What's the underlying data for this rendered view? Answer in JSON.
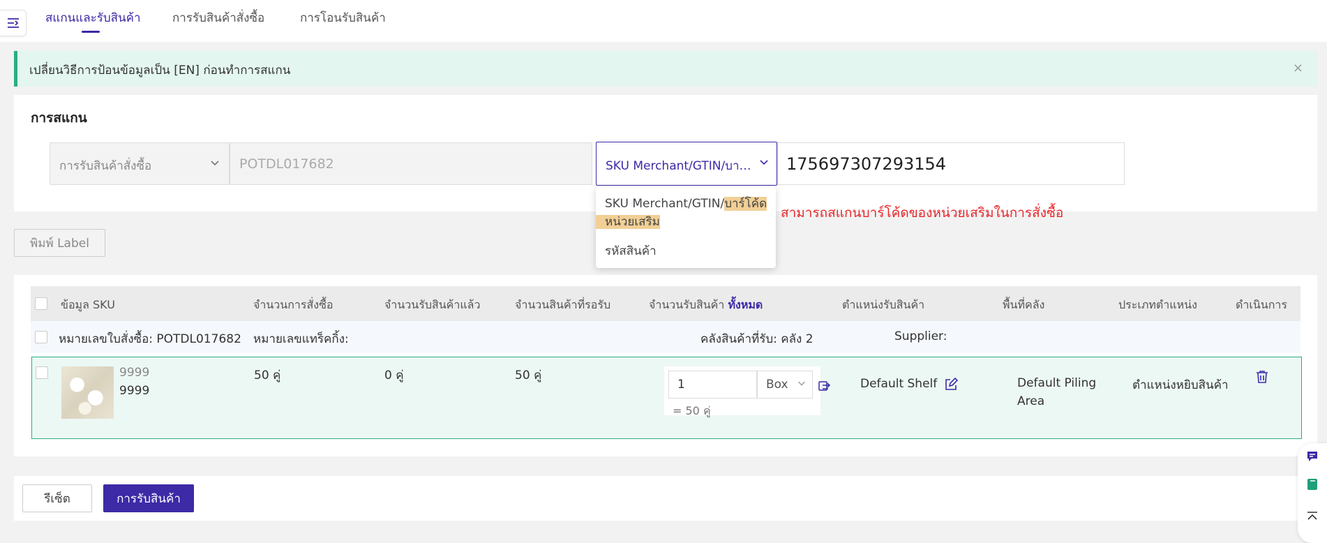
{
  "tabs": [
    {
      "label": "สแกนและรับสินค้า",
      "active": true
    },
    {
      "label": "การรับสินค้าสั่งซื้อ",
      "active": false
    },
    {
      "label": "การโอนรับสินค้า",
      "active": false
    }
  ],
  "alert": {
    "text": "เปลี่ยนวิธีการป้อนข้อมูลเป็น [EN] ก่อนทำการสแกน",
    "close": "×"
  },
  "scan": {
    "title": "การสแกน",
    "type_select": "การรับสินค้าสั่งซื้อ",
    "po_value": "POTDL017682",
    "code_type_select": "SKU Merchant/GTIN/บาร์โค้ด",
    "barcode_value": "175697307293154"
  },
  "dropdown": {
    "option1_part1": "SKU Merchant/GTIN/",
    "option1_part2": "บาร์โค้ด",
    "option1_part3": "หน่วยเสริม",
    "option2": "รหัสสินค้า",
    "annotation": "สามารถสแกนบาร์โค้ดของหน่วยเสริมในการสั่งซื้อ"
  },
  "print_label": "พิมพ์ Label",
  "table": {
    "headers": {
      "sku_info": "ข้อมูล SKU",
      "order_qty": "จำนวนการสั่งซื้อ",
      "received_qty": "จำนวนรับสินค้าแล้ว",
      "pending_qty": "จำนวนสินค้าที่รอรับ",
      "receive_qty": "จำนวนรับสินค้า",
      "receive_all": "ทั้งหมด",
      "location": "ตำแหน่งรับสินค้า",
      "warehouse_area": "พื้นที่คลัง",
      "location_type": "ประเภทตำแหน่ง",
      "actions": "ดำเนินการ"
    },
    "order": {
      "po_label": "หมายเลขใบสั่งซื้อ: POTDL017682",
      "tracking_label": "หมายเลขแทร็คกิ้ง:",
      "warehouse_label": "คลังสินค้าที่รับ: คลัง 2",
      "supplier_label": "Supplier:"
    },
    "item": {
      "sku_top": "9999",
      "sku_bottom": "9999",
      "order_qty": "50 คู่",
      "received_qty": "0 คู่",
      "pending_qty": "50 คู่",
      "receive_input": "1",
      "unit": "Box",
      "equivalent": "= 50 คู่",
      "location": "Default Shelf",
      "area_line1": "Default Piling",
      "area_line2": "Area",
      "location_type": "ตำแหน่งหยิบสินค้า"
    }
  },
  "footer": {
    "reset": "รีเซ็ต",
    "receive": "การรับสินค้า"
  },
  "colors": {
    "accent": "#3c2aa6",
    "success": "#2aae82",
    "annotation": "#e8262a",
    "highlight": "#f1cf95"
  }
}
